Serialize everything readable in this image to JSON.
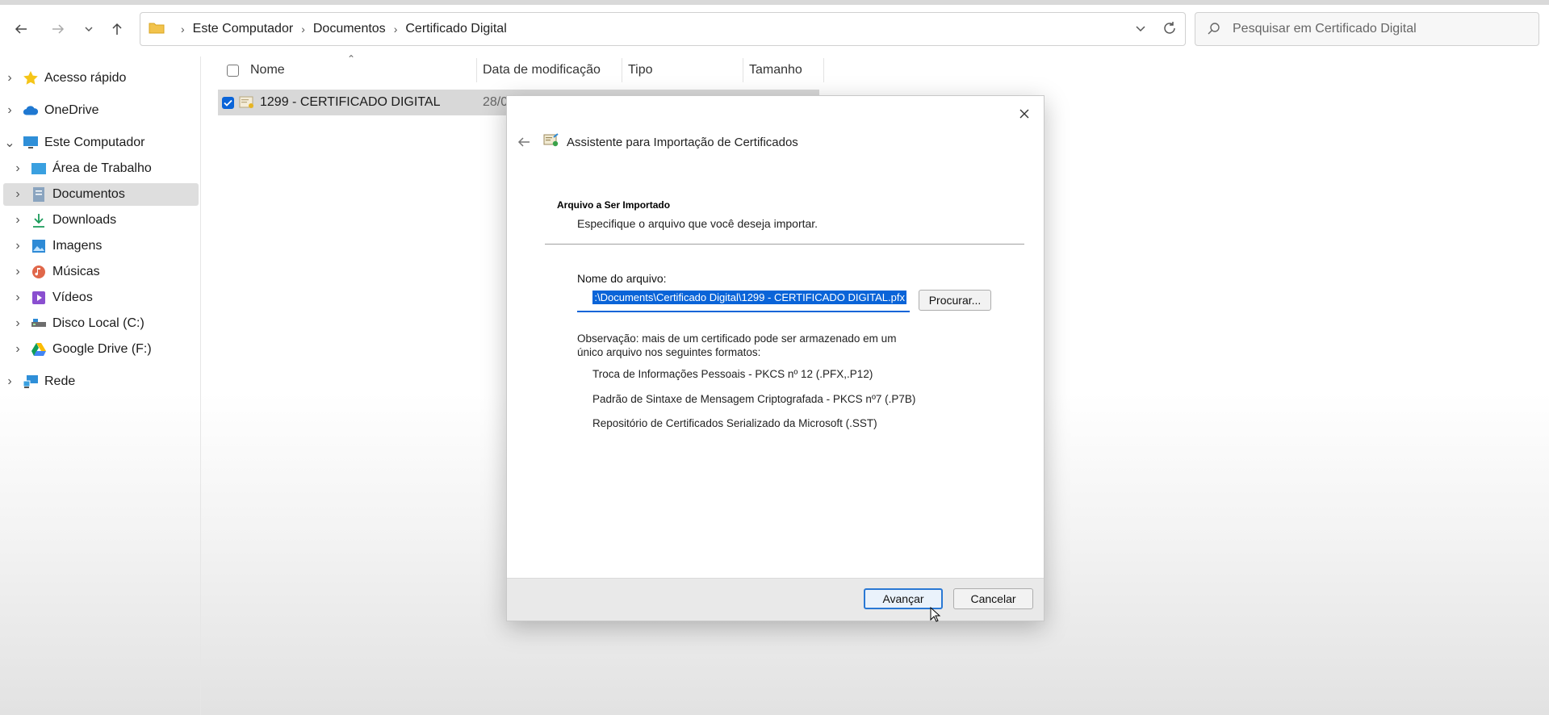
{
  "breadcrumbs": [
    "Este Computador",
    "Documentos",
    "Certificado Digital"
  ],
  "search": {
    "placeholder": "Pesquisar em Certificado Digital"
  },
  "sidebar": {
    "items": [
      {
        "label": "Acesso rápido",
        "icon": "star-icon"
      },
      {
        "label": "OneDrive",
        "icon": "cloud-icon"
      },
      {
        "label": "Este Computador",
        "icon": "monitor-icon"
      },
      {
        "label": "Área de Trabalho",
        "icon": "desktop-icon"
      },
      {
        "label": "Documentos",
        "icon": "documents-icon"
      },
      {
        "label": "Downloads",
        "icon": "download-icon"
      },
      {
        "label": "Imagens",
        "icon": "image-icon"
      },
      {
        "label": "Músicas",
        "icon": "music-icon"
      },
      {
        "label": "Vídeos",
        "icon": "video-icon"
      },
      {
        "label": "Disco Local (C:)",
        "icon": "drive-icon"
      },
      {
        "label": "Google Drive (F:)",
        "icon": "google-drive-icon"
      },
      {
        "label": "Rede",
        "icon": "network-icon"
      }
    ]
  },
  "columns": {
    "name": "Nome",
    "date": "Data de modificação",
    "type": "Tipo",
    "size": "Tamanho"
  },
  "file_row": {
    "name": "1299 - CERTIFICADO DIGITAL",
    "date": "28/0"
  },
  "dialog": {
    "title": "Assistente para Importação de Certificados",
    "section_title": "Arquivo a Ser Importado",
    "section_subtitle": "Especifique o arquivo que você deseja importar.",
    "file_label": "Nome do arquivo:",
    "file_value": ":\\Documents\\Certificado Digital\\1299 - CERTIFICADO DIGITAL.pfx",
    "browse_label": "Procurar...",
    "note_line1": "Observação: mais de um certificado pode ser armazenado em um",
    "note_line2": "único arquivo nos seguintes formatos:",
    "formats": [
      "Troca de Informações Pessoais - PKCS nº 12 (.PFX,.P12)",
      "Padrão de Sintaxe de Mensagem Criptografada - PKCS nº7 (.P7B)",
      "Repositório de Certificados Serializado da Microsoft (.SST)"
    ],
    "next_label": "Avançar",
    "cancel_label": "Cancelar"
  },
  "colors": {
    "accent": "#0a64d8",
    "selection": "#d8d8d8"
  }
}
